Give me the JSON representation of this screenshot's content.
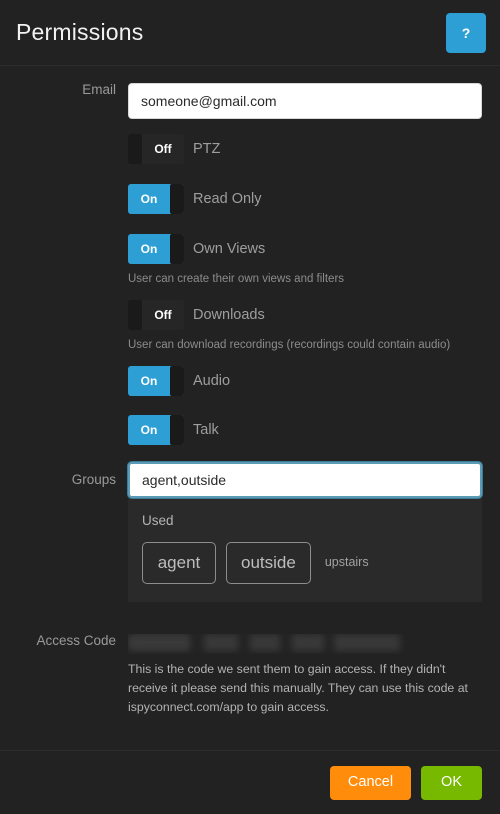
{
  "header": {
    "title": "Permissions",
    "help_label": "?",
    "help_color": "#2e9fd4"
  },
  "form": {
    "email": {
      "label": "Email",
      "value": "someone@gmail.com",
      "placeholder": "Email"
    },
    "groups": {
      "label": "Groups",
      "value": "agent,outside",
      "placeholder": "Groups"
    },
    "access_code": {
      "label": "Access Code",
      "value": "",
      "redacted": "true",
      "hint": "This is the code we sent them to gain access. If they didn't receive it please send this manually. They can use this code at ispyconnect.com/app to gain access."
    }
  },
  "permissions": [
    {
      "name": "ptz",
      "label": "PTZ",
      "state": "Off",
      "on": false,
      "hint": ""
    },
    {
      "name": "read-only",
      "label": "Read Only",
      "state": "On",
      "on": true,
      "hint": ""
    },
    {
      "name": "own-views",
      "label": "Own Views",
      "state": "On",
      "on": true,
      "hint": "User can create their own views and filters"
    },
    {
      "name": "downloads",
      "label": "Downloads",
      "state": "Off",
      "on": false,
      "hint": "User can download recordings (recordings could contain audio)"
    },
    {
      "name": "audio",
      "label": "Audio",
      "state": "On",
      "on": true,
      "hint": ""
    },
    {
      "name": "talk",
      "label": "Talk",
      "state": "On",
      "on": true,
      "hint": ""
    }
  ],
  "used_panel": {
    "title": "Used",
    "chips": [
      "agent",
      "outside"
    ],
    "plain": "upstairs"
  },
  "footer": {
    "cancel_label": "Cancel",
    "ok_label": "OK",
    "cancel_color": "#ff8c0a",
    "ok_color": "#76b900"
  }
}
